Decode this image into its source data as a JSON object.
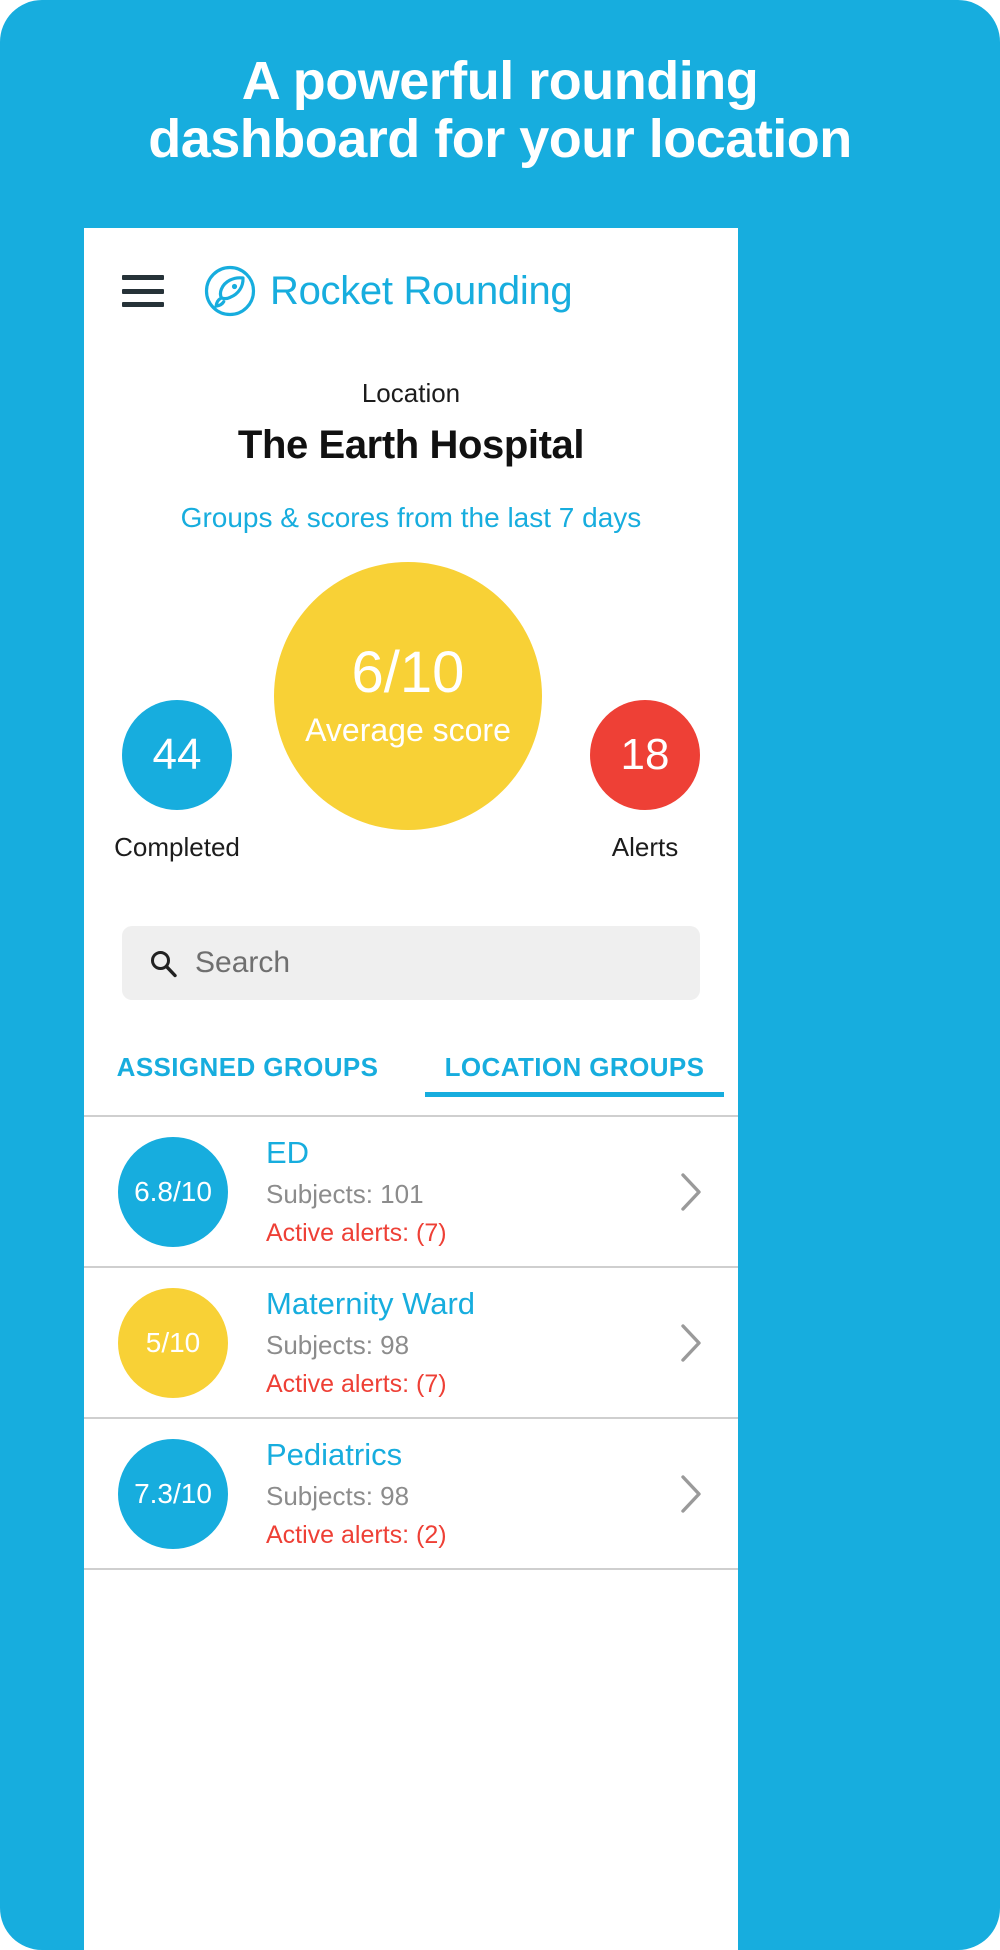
{
  "promo": {
    "headline_line1": "A powerful rounding",
    "headline_line2": "dashboard for your location",
    "background_color": "#17ADDE"
  },
  "colors": {
    "brand_blue": "#17ADDE",
    "score_yellow": "#F8D136",
    "alert_red": "#EE4036",
    "muted_grey": "#8C8C8C"
  },
  "appbar": {
    "menu_icon": "hamburger-menu-icon",
    "logo_icon": "rocket-rounding-logo-icon",
    "brand_name": "Rocket Rounding"
  },
  "location": {
    "label": "Location",
    "name": "The Earth Hospital",
    "subtitle": "Groups & scores from the last 7 days"
  },
  "stats": {
    "average": {
      "value": "6/10",
      "caption": "Average score",
      "color": "#F8D136"
    },
    "completed": {
      "value": "44",
      "caption": "Completed",
      "color": "#17ADDE"
    },
    "alerts": {
      "value": "18",
      "caption": "Alerts",
      "color": "#EE4036"
    }
  },
  "search": {
    "icon": "search-icon",
    "placeholder": "Search",
    "value": ""
  },
  "tabs": [
    {
      "label": "ASSIGNED GROUPS",
      "active": false
    },
    {
      "label": "LOCATION GROUPS",
      "active": true
    }
  ],
  "groups": [
    {
      "score": "6.8/10",
      "score_color": "#17ADDE",
      "name": "ED",
      "subjects": "Subjects: 101",
      "alerts": "Active alerts: (7)",
      "chevron": "chevron-right-icon"
    },
    {
      "score": "5/10",
      "score_color": "#F8D136",
      "name": "Maternity Ward",
      "subjects": "Subjects: 98",
      "alerts": "Active alerts: (7)",
      "chevron": "chevron-right-icon"
    },
    {
      "score": "7.3/10",
      "score_color": "#17ADDE",
      "name": "Pediatrics",
      "subjects": "Subjects: 98",
      "alerts": "Active alerts: (2)",
      "chevron": "chevron-right-icon"
    }
  ]
}
